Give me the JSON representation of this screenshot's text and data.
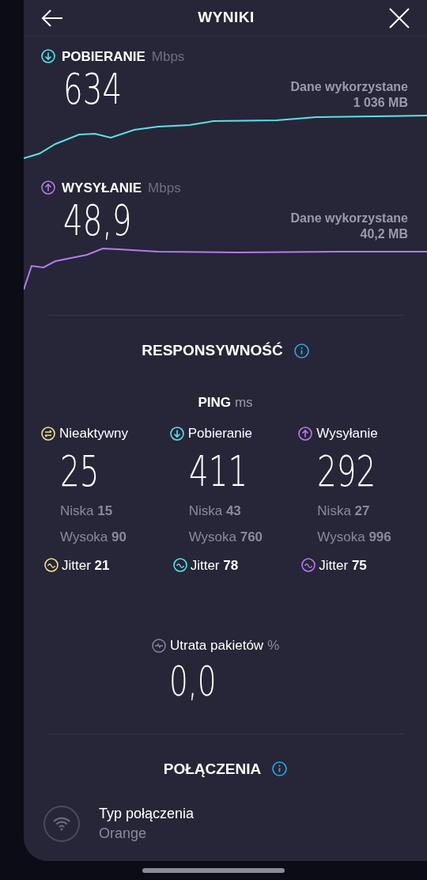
{
  "header": {
    "title": "WYNIKI"
  },
  "speeds": [
    {
      "kind": "download",
      "label": "POBIERANIE",
      "unit": "Mbps",
      "value": "634",
      "data_label": "Dane wykorzystane",
      "data_value": "1 036 MB",
      "color": "#5ce1e6"
    },
    {
      "kind": "upload",
      "label": "WYSYŁANIE",
      "unit": "Mbps",
      "value": "48,9",
      "data_label": "Dane wykorzystane",
      "data_value": "40,2 MB",
      "color": "#b57bee"
    }
  ],
  "responsiveness": {
    "title": "RESPONSYWNOŚĆ",
    "ping_label": "PING",
    "ping_unit": "ms",
    "columns": [
      {
        "kind": "idle",
        "label": "Nieaktywny",
        "value": "25",
        "low_label": "Niska",
        "low": "15",
        "high_label": "Wysoka",
        "high": "90",
        "jitter_label": "Jitter",
        "jitter": "21",
        "color": "#f3e08a"
      },
      {
        "kind": "download",
        "label": "Pobieranie",
        "value": "411",
        "low_label": "Niska",
        "low": "43",
        "high_label": "Wysoka",
        "high": "760",
        "jitter_label": "Jitter",
        "jitter": "78",
        "color": "#5ce1e6"
      },
      {
        "kind": "upload",
        "label": "Wysyłanie",
        "value": "292",
        "low_label": "Niska",
        "low": "27",
        "high_label": "Wysoka",
        "high": "996",
        "jitter_label": "Jitter",
        "jitter": "75",
        "color": "#b57bee"
      }
    ]
  },
  "packet_loss": {
    "label": "Utrata pakietów",
    "unit": "%",
    "value": "0,0"
  },
  "connections": {
    "title": "POŁĄCZENIA",
    "items": [
      {
        "kind": "wifi",
        "label": "Typ połączenia",
        "value": "Orange"
      }
    ]
  }
}
